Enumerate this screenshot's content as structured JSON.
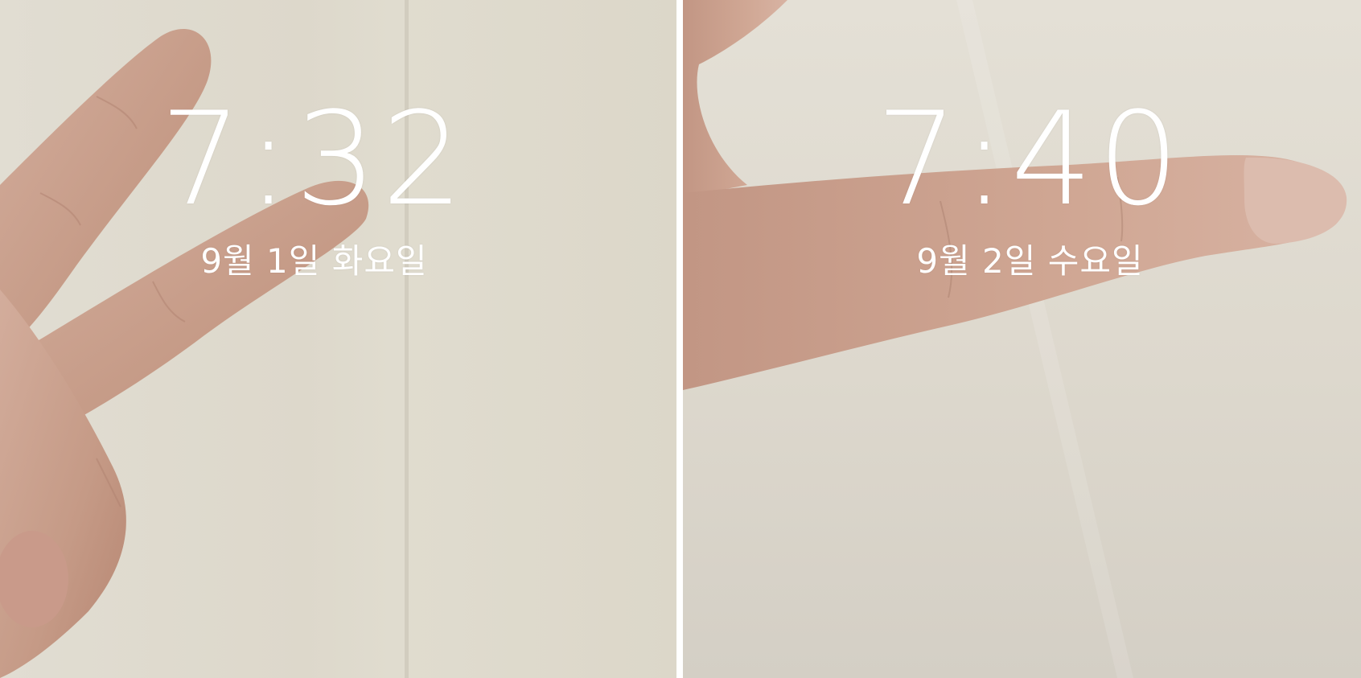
{
  "screens": [
    {
      "time": "7:32",
      "date": "9월 1일 화요일"
    },
    {
      "time": "7:40",
      "date": "9월 2일 수요일"
    }
  ]
}
